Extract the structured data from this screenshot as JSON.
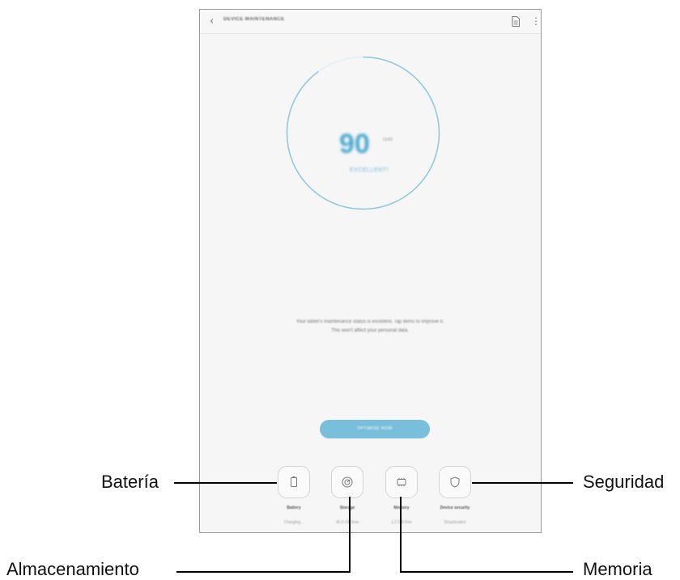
{
  "screen": {
    "title": "DEVICE MAINTENANCE",
    "back_icon": "chevron-left-icon",
    "doc_icon": "document-icon",
    "more_icon": "more-vertical-icon"
  },
  "score": {
    "value": "90",
    "max": "/100",
    "status": "EXCELLENT!",
    "ring_fraction": 0.9,
    "ring_color": "#8ec6e0"
  },
  "status_message": {
    "line1": "Your tablet's maintenance status is excellent. Tap items to improve it.",
    "line2": "This won't affect your personal data."
  },
  "optimise_button": {
    "label": "OPTIMISE NOW",
    "color": "#79bfdc"
  },
  "tiles": [
    {
      "icon": "battery-icon",
      "label": "Battery",
      "sub": "Charging..."
    },
    {
      "icon": "storage-icon",
      "label": "Storage",
      "sub": "45.6 GB free"
    },
    {
      "icon": "memory-icon",
      "label": "Memory",
      "sub": "1.2 GB free"
    },
    {
      "icon": "shield-icon",
      "label": "Device security",
      "sub": "Deactivated"
    }
  ],
  "callouts": {
    "bateria": "Batería",
    "seguridad": "Seguridad",
    "almacenamiento": "Almacenamiento",
    "memoria": "Memoria"
  }
}
